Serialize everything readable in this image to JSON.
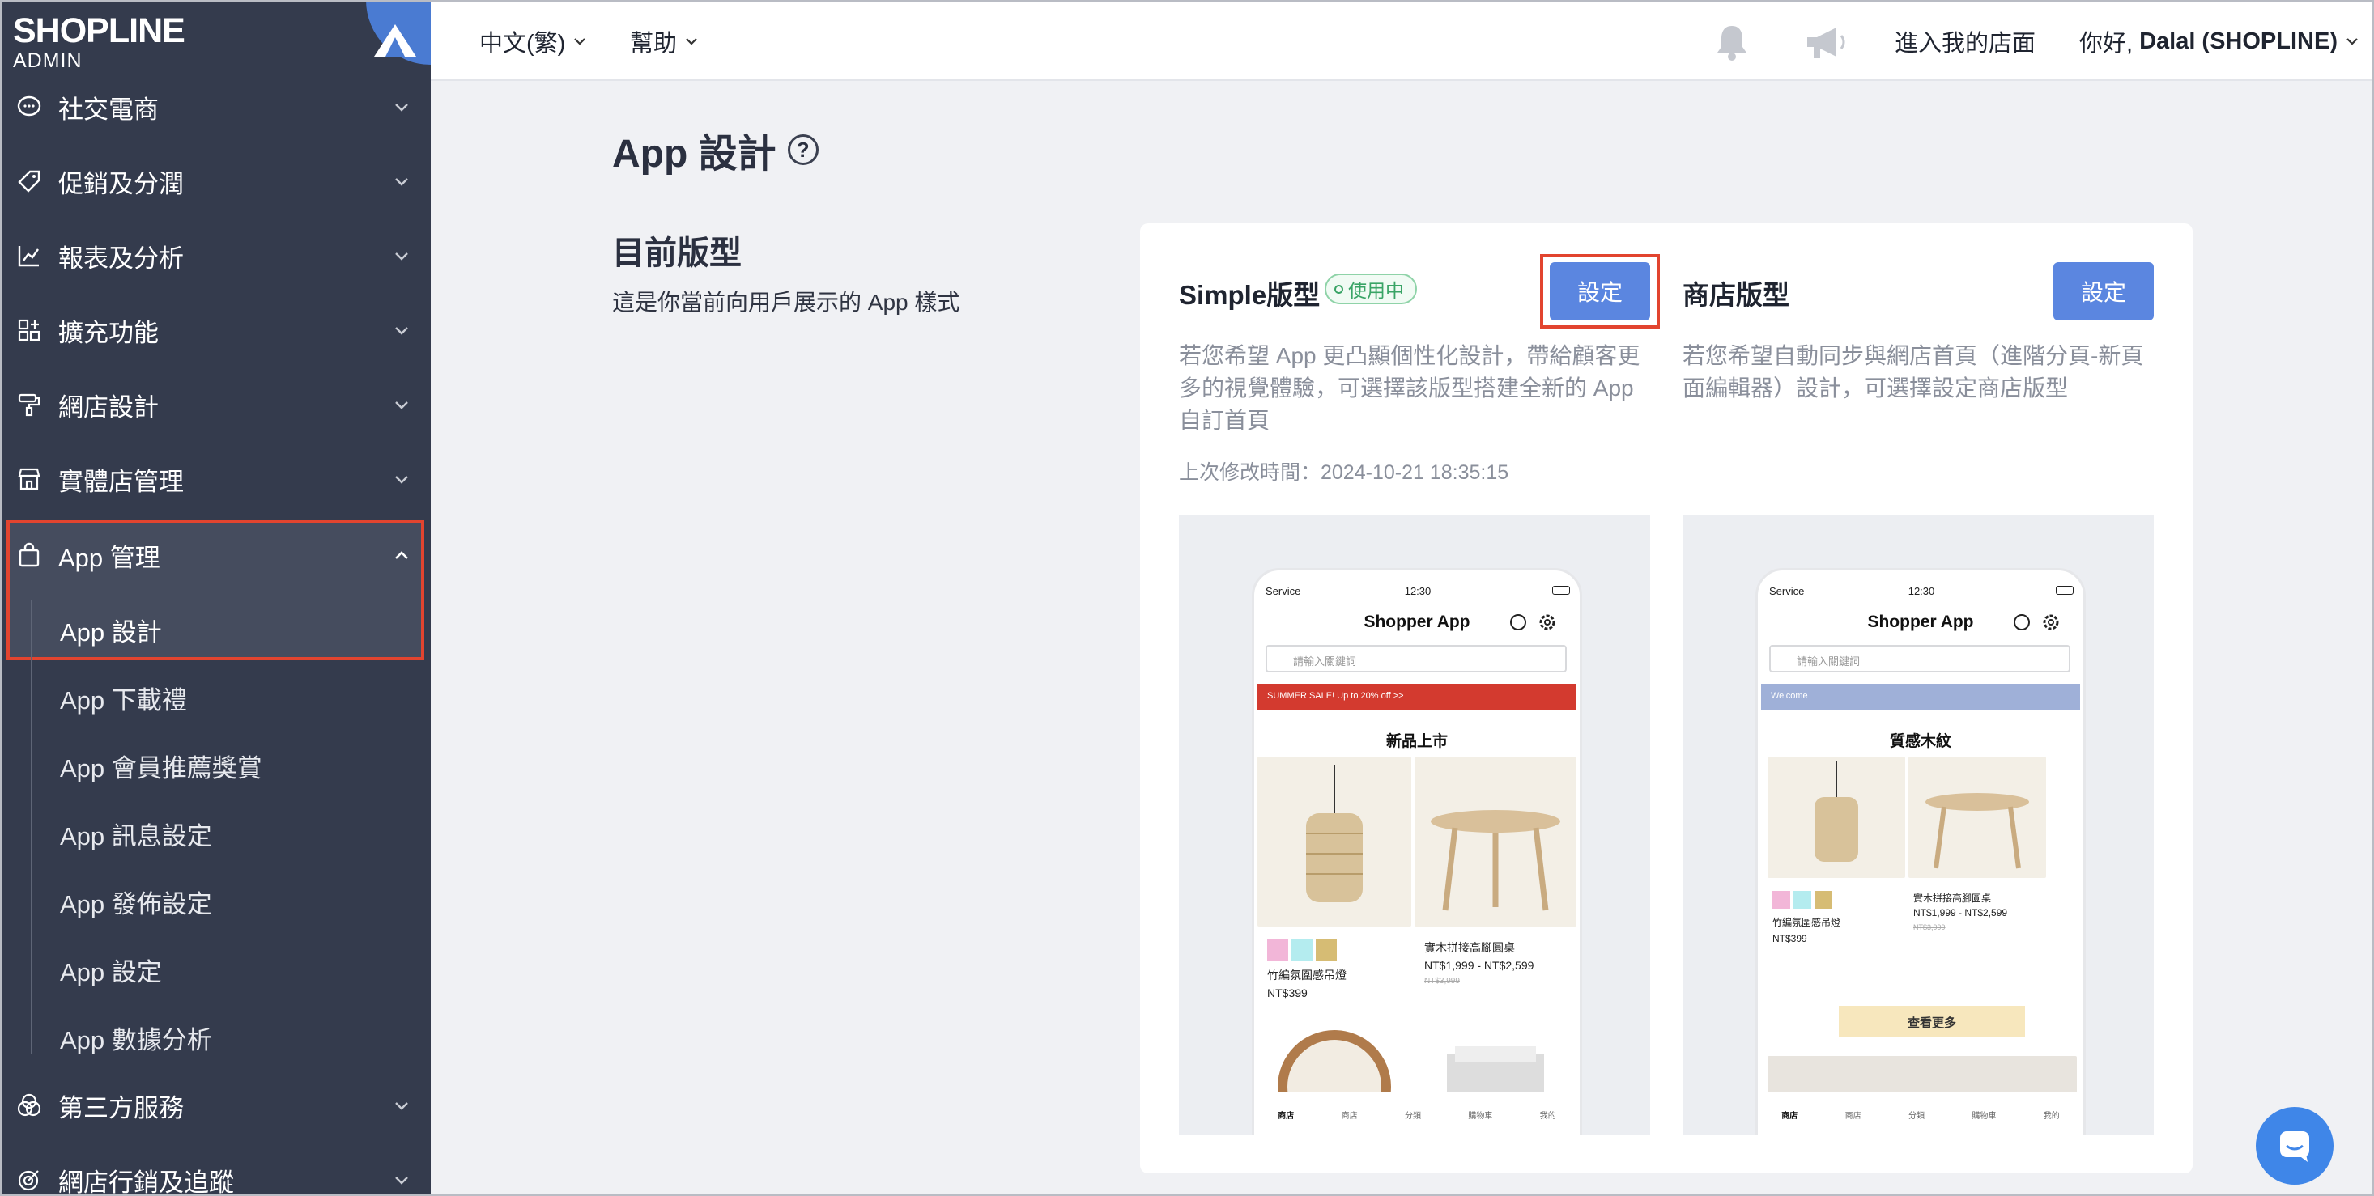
{
  "brand": {
    "logo": "SHOPLINE",
    "sub": "ADMIN"
  },
  "sidebar": {
    "items": [
      {
        "label": "社交電商",
        "icon": "chat-bubble-icon"
      },
      {
        "label": "促銷及分潤",
        "icon": "tag-icon"
      },
      {
        "label": "報表及分析",
        "icon": "chart-icon"
      },
      {
        "label": "擴充功能",
        "icon": "apps-icon"
      },
      {
        "label": "網店設計",
        "icon": "paint-roller-icon"
      },
      {
        "label": "實體店管理",
        "icon": "store-icon"
      },
      {
        "label": "App 管理",
        "icon": "shopping-bag-icon"
      },
      {
        "label": "第三方服務",
        "icon": "venn-icon"
      },
      {
        "label": "網店行銷及追蹤",
        "icon": "target-icon"
      }
    ],
    "sub_items": [
      {
        "label": "App 設計",
        "active": true
      },
      {
        "label": "App 下載禮"
      },
      {
        "label": "App 會員推薦獎賞"
      },
      {
        "label": "App 訊息設定"
      },
      {
        "label": "App 發佈設定"
      },
      {
        "label": "App 設定"
      },
      {
        "label": "App 數據分析"
      }
    ]
  },
  "topbar": {
    "language": "中文(繁)",
    "help": "幫助",
    "enter_store": "進入我的店面",
    "greeting": "你好,",
    "user": "Dalal (SHOPLINE)"
  },
  "main": {
    "title": "App 設計",
    "help_glyph": "?",
    "section_title": "目前版型",
    "section_desc": "這是你當前向用戶展示的 App 樣式",
    "simple": {
      "title": "Simple版型",
      "badge": "使用中",
      "button": "設定",
      "desc_lines": [
        "若您希望 App 更凸顯個性化設計，帶給顧客更",
        "多的視覺體驗，可選擇該版型搭建全新的 App",
        "自訂首頁"
      ],
      "modified": "上次修改時間：2024-10-21 18:35:15"
    },
    "store": {
      "title": "商店版型",
      "button": "設定",
      "desc_lines": [
        "若您希望自動同步與網店首頁（進階分頁-新頁",
        "面編輯器）設計，可選擇設定商店版型"
      ]
    }
  },
  "phone_simple": {
    "carrier": "Service",
    "time": "12:30",
    "title": "Shopper App",
    "search": "請輸入關鍵詞",
    "banner": "SUMMER SALE! Up to 20% off >>",
    "banner_color": "#d33a2f",
    "section": "新品上市",
    "product1": {
      "name": "竹編氛圍感吊燈",
      "price": "NT$399"
    },
    "product2": {
      "name": "實木拼接高腳圓桌",
      "price": "NT$1,999 - NT$2,599",
      "old": "NT$3,999"
    },
    "nav": [
      "商店",
      "商店",
      "分類",
      "購物車",
      "我的"
    ]
  },
  "phone_store": {
    "carrier": "Service",
    "time": "12:30",
    "title": "Shopper App",
    "search": "請輸入關鍵詞",
    "banner": "Welcome",
    "banner_color": "#9fb0d8",
    "section": "質感木紋",
    "product1": {
      "name": "竹編氛圍感吊燈",
      "price": "NT$399"
    },
    "product2": {
      "name": "實木拼接高腳圓桌",
      "price": "NT$1,999 - NT$2,599",
      "old": "NT$3,999"
    },
    "more": "查看更多",
    "nav": [
      "商店",
      "商店",
      "分類",
      "購物車",
      "我的"
    ]
  },
  "colors": {
    "sidebar": "#343b4d",
    "accent": "#5b86e0",
    "highlight": "#e2442f",
    "success": "#3aa466"
  }
}
